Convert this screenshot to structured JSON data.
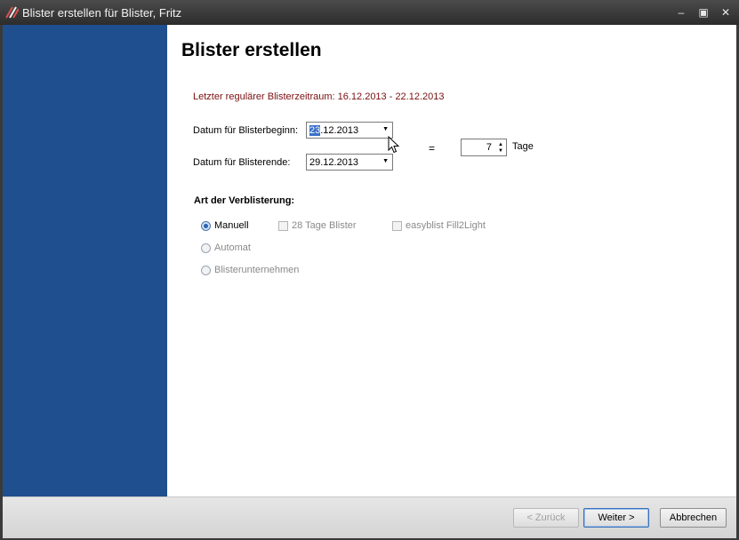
{
  "window": {
    "title": "Blister erstellen für Blister, Fritz"
  },
  "page": {
    "title": "Blister erstellen",
    "info": "Letzter regulärer Blisterzeitraum: 16.12.2013 - 22.12.2013"
  },
  "form": {
    "begin_label": "Datum für Blisterbeginn:",
    "begin_day": "23",
    "begin_rest": ".12.2013",
    "end_label": "Datum für Blisterende:",
    "end_value": "29.12.2013",
    "equals": "=",
    "days_value": "7",
    "days_unit": "Tage"
  },
  "mode": {
    "heading": "Art der Verblisterung:",
    "options": [
      {
        "label": "Manuell",
        "selected": true
      },
      {
        "label": "Automat",
        "selected": false
      },
      {
        "label": "Blisterunternehmen",
        "selected": false
      }
    ],
    "checkboxes": [
      {
        "label": "28 Tage Blister",
        "checked": false
      },
      {
        "label": "easyblist Fill2Light",
        "checked": false
      }
    ]
  },
  "buttons": {
    "back": "< Zurück",
    "next": "Weiter >",
    "cancel": "Abbrechen"
  }
}
